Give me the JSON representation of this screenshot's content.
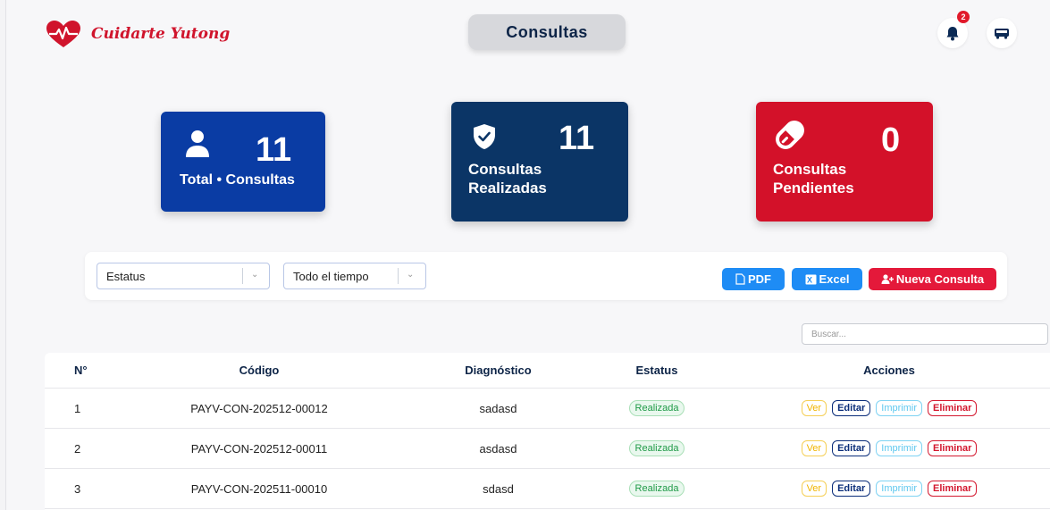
{
  "header": {
    "brand": "Cuidarte Yutong",
    "page_title": "Consultas",
    "notification_count": "2",
    "icons": [
      "heart-pulse-logo-icon",
      "bell-icon",
      "bus-icon"
    ]
  },
  "stats": {
    "total": {
      "value": "11",
      "label": "Total • Consultas",
      "icon": "user-icon",
      "color": "#0a3ca4"
    },
    "done": {
      "value": "11",
      "label_1": "Consultas",
      "label_2": "Realizadas",
      "icon": "shield-check-icon",
      "color": "#0b3566"
    },
    "pending": {
      "value": "0",
      "label_1": "Consultas",
      "label_2": "Pendientes",
      "icon": "pill-icon",
      "color": "#d31129"
    }
  },
  "filters": {
    "status_placeholder": "Estatus",
    "time_value": "Todo el tiempo",
    "pdf_label": "PDF",
    "excel_label": "Excel",
    "new_label": "Nueva Consulta"
  },
  "search": {
    "placeholder": "Buscar..."
  },
  "table": {
    "columns": [
      "N°",
      "Código",
      "Diagnóstico",
      "Estatus",
      "Acciones"
    ],
    "rows": [
      {
        "n": "1",
        "code": "PAYV-CON-202512-00012",
        "diagnosis": "sadasd",
        "status": "Realizada"
      },
      {
        "n": "2",
        "code": "PAYV-CON-202512-00011",
        "diagnosis": "asdasd",
        "status": "Realizada"
      },
      {
        "n": "3",
        "code": "PAYV-CON-202511-00010",
        "diagnosis": "sdasd",
        "status": "Realizada"
      }
    ],
    "actions": {
      "view": "Ver",
      "edit": "Editar",
      "print": "Imprimir",
      "delete": "Eliminar"
    }
  }
}
